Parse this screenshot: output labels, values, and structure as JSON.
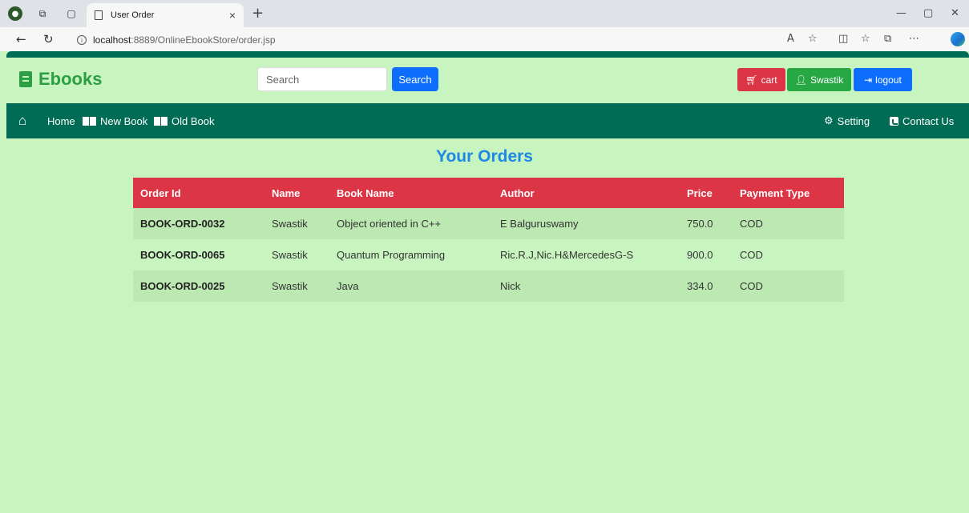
{
  "browser": {
    "tab_title": "User Order",
    "url_host": "localhost",
    "url_rest": ":8889/OnlineEbookStore/order.jsp"
  },
  "header": {
    "brand": "Ebooks",
    "search_placeholder": "Search",
    "search_button": "Search",
    "cart_label": "cart",
    "user_label": "Swastik",
    "logout_label": "logout"
  },
  "navbar": {
    "home": "Home",
    "new_book": "New Book",
    "old_book": "Old Book",
    "setting": "Setting",
    "contact": "Contact Us"
  },
  "orders": {
    "title": "Your Orders",
    "columns": [
      "Order Id",
      "Name",
      "Book Name",
      "Author",
      "Price",
      "Payment Type"
    ],
    "rows": [
      {
        "order_id": "BOOK-ORD-0032",
        "name": "Swastik",
        "book": "Object oriented in C++",
        "author": "E Balguruswamy",
        "price": "750.0",
        "payment": "COD"
      },
      {
        "order_id": "BOOK-ORD-0065",
        "name": "Swastik",
        "book": "Quantum Programming",
        "author": "Ric.R.J,Nic.H&MercedesG-S",
        "price": "900.0",
        "payment": "COD"
      },
      {
        "order_id": "BOOK-ORD-0025",
        "name": "Swastik",
        "book": "Java",
        "author": "Nick",
        "price": "334.0",
        "payment": "COD"
      }
    ]
  },
  "colors": {
    "page_bg": "#c8f4c0",
    "nav_bg": "#006c55",
    "brand": "#2e9e45",
    "table_header": "#dc3545",
    "title": "#1e88e5"
  }
}
